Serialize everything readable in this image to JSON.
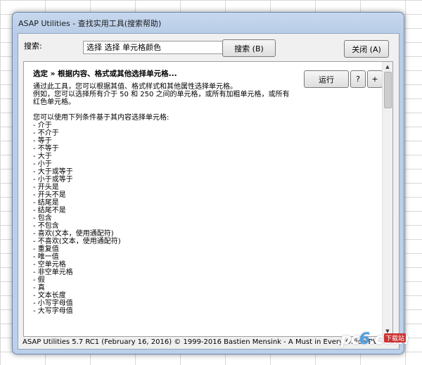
{
  "window": {
    "title": "ASAP Utilities - 查找实用工具(搜索帮助)"
  },
  "search": {
    "label": "搜索:",
    "value": "选择 选择 单元格颜色",
    "button": "搜索 (B)"
  },
  "close_button": "关闭 (A)",
  "panel": {
    "heading": "选定 » 根据内容、格式或其他选择单元格...",
    "run_button": "运行",
    "help_button": "?",
    "plus_button": "+",
    "description": "通过此工具，您可以根据其值、格式样式和其他属性选择单元格。\n例如，您可以选择所有介于 50 和 250 之间的单元格，或所有加粗单元格，或所有红色单元格。",
    "list_intro": "您可以使用下列条件基于其内容选择单元格:",
    "items": [
      "- 介于",
      "- 不介于",
      "- 等于",
      "- 不等于",
      "- 大于",
      "- 小于",
      "- 大于或等于",
      "- 小于或等于",
      "- 开头是",
      "- 开头不是",
      "- 结尾是",
      "- 结尾不是",
      "- 包含",
      "- 不包含",
      "- 喜欢(文本，使用通配符)",
      "- 不喜欢(文本，使用通配符)",
      "- 重复值",
      "- 唯一值",
      "- 空单元格",
      "- 非空单元格",
      "- 假",
      "- 真",
      "- 文本长度",
      "- 小写字母值",
      "- 大写字母值"
    ]
  },
  "footer": "ASAP Utilities 5.7 RC1 (February 16, 2016)  © 1999-2016 Bastien Mensink - A Must in Every Office BV",
  "watermark": {
    "text_a": "pc",
    "text_b": "6",
    "text_c": ".com",
    "sub": "下载站"
  }
}
